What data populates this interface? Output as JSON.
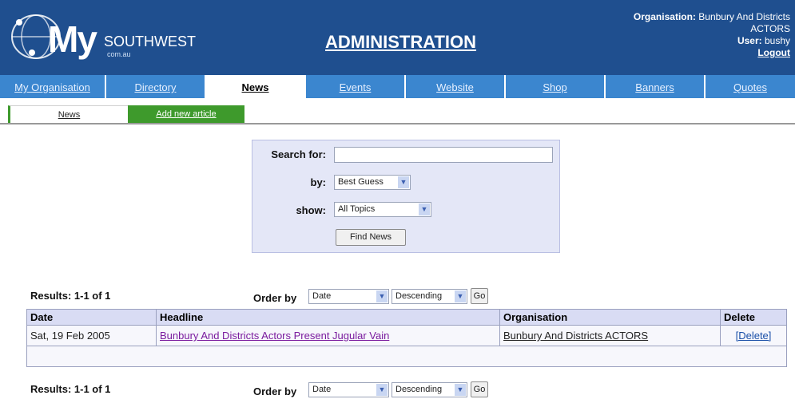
{
  "header": {
    "logo_my": "My",
    "logo_southwest": "SOUTHWEST",
    "logo_domain": "com.au",
    "title": "ADMINISTRATION",
    "org_label": "Organisation:",
    "org_name_1": "Bunbury And Districts",
    "org_name_2": "ACTORS",
    "user_label": "User:",
    "user_name": "bushy",
    "logout": "Logout",
    "bg_color": "#1f4f8f"
  },
  "tabs": [
    {
      "label": "My Organisation"
    },
    {
      "label": "Directory"
    },
    {
      "label": "News",
      "active": true
    },
    {
      "label": "Events"
    },
    {
      "label": "Website"
    },
    {
      "label": "Shop"
    },
    {
      "label": "Banners"
    },
    {
      "label": "Quotes"
    }
  ],
  "subtabs": {
    "news": "News",
    "add": "Add new article"
  },
  "search": {
    "search_for_label": "Search for:",
    "search_value": "",
    "by_label": "by:",
    "by_value": "Best Guess",
    "show_label": "show:",
    "show_value": "All Topics",
    "button": "Find News"
  },
  "results_top": {
    "results": "Results: 1-1 of 1",
    "order_by": "Order by",
    "order_field": "Date",
    "order_dir": "Descending",
    "go": "Go"
  },
  "table": {
    "headers": [
      "Date",
      "Headline",
      "Organisation",
      "Delete"
    ],
    "rows": [
      {
        "date": "Sat, 19 Feb 2005",
        "headline": "Bunbury And Districts Actors Present Jugular Vain",
        "organisation": "Bunbury And Districts ACTORS",
        "delete": "[Delete]"
      }
    ]
  },
  "results_bottom": {
    "results": "Results: 1-1 of 1",
    "order_by": "Order by",
    "order_field": "Date",
    "order_dir": "Descending",
    "go": "Go"
  }
}
